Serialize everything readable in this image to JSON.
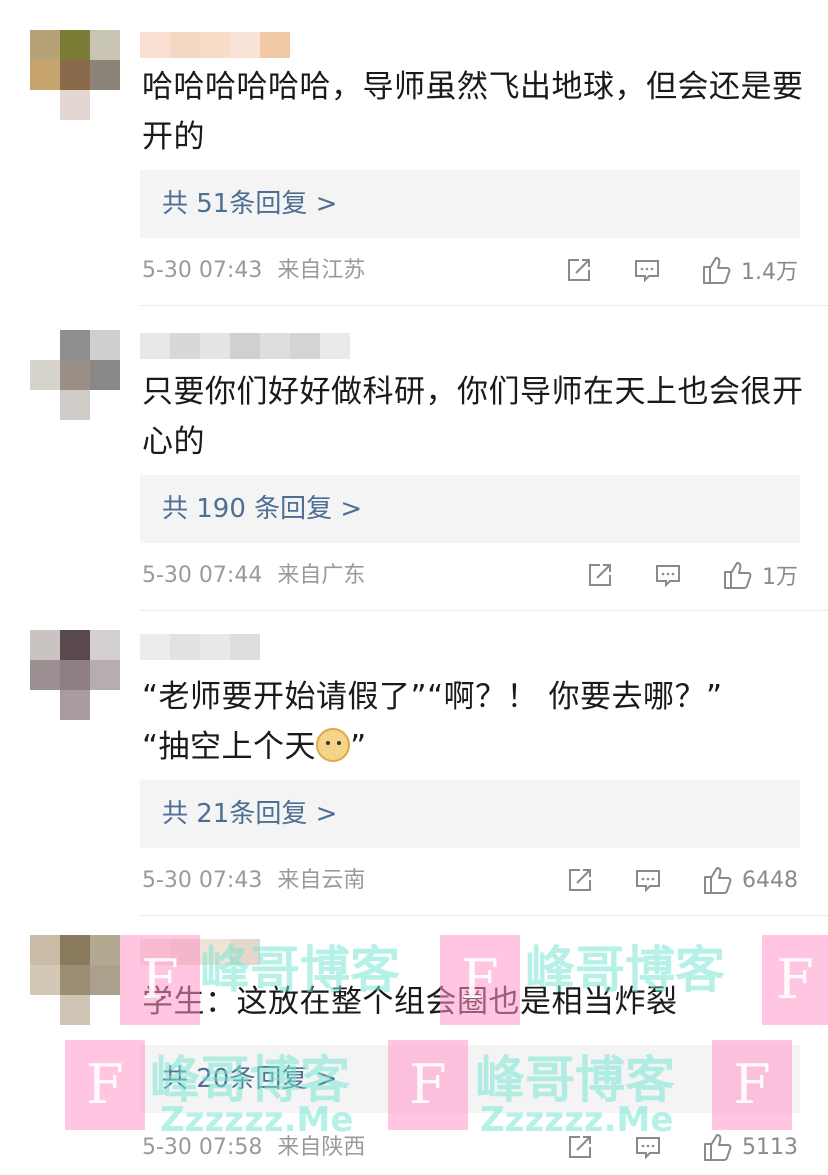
{
  "comments": [
    {
      "text": "哈哈哈哈哈哈，导师虽然飞出地球，但会还是要开的",
      "replies": "共 51条回复 >",
      "time": "5-30 07:43",
      "location": "来自江苏",
      "likes": "1.4万"
    },
    {
      "text": "只要你们好好做科研，你们导师在天上也会很开心的",
      "replies": "共 190 条回复 >",
      "time": "5-30 07:44",
      "location": "来自广东",
      "likes": "1万"
    },
    {
      "text_line1": "“老师要开始请假了”“啊？！ 你要去哪？”",
      "text_line2": "“抽空上个天",
      "text_line2_end": "”",
      "emoji": "doge-emoji",
      "replies": "共 21条回复 >",
      "time": "5-30 07:43",
      "location": "来自云南",
      "likes": "6448"
    },
    {
      "text": "学生：这放在整个组会圈也是相当炸裂",
      "replies": "共 20条回复 >",
      "time": "5-30 07:58",
      "location": "来自陕西",
      "likes": "5113"
    }
  ],
  "icons": {
    "repost": "repost-icon",
    "comment": "comment-icon",
    "like": "thumbs-up-icon"
  },
  "watermark": {
    "text": "峰哥博客",
    "url": "Zzzzzz.Me",
    "letter": "F"
  },
  "colors": {
    "reply_link": "#4e6f93",
    "reply_bg": "#f4f4f4",
    "meta_gray": "#9a9a9a",
    "watermark_green": "#78e6d2",
    "watermark_pink": "#ff96c8"
  }
}
